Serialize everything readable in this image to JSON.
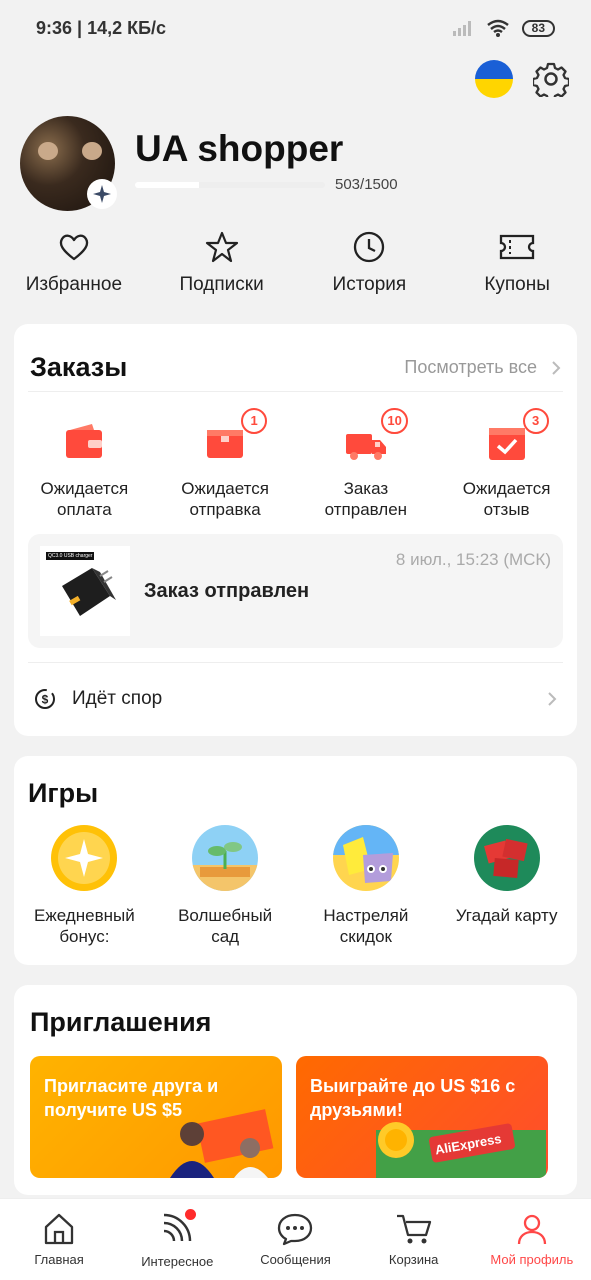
{
  "status_bar": {
    "time_speed": "9:36 | 14,2 КБ/с",
    "battery": "83"
  },
  "profile": {
    "username": "UA shopper",
    "progress_text": "503/1500",
    "progress": 0.335
  },
  "quick_links": [
    "Избранное",
    "Подписки",
    "История",
    "Купоны"
  ],
  "orders": {
    "title": "Заказы",
    "view_all": "Посмотреть все",
    "statuses": [
      {
        "label1": "Ожидается",
        "label2": "оплата",
        "count": ""
      },
      {
        "label1": "Ожидается",
        "label2": "отправка",
        "count": "1"
      },
      {
        "label1": "Заказ",
        "label2": "отправлен",
        "count": "10"
      },
      {
        "label1": "Ожидается",
        "label2": "отзыв",
        "count": "3"
      }
    ],
    "shipped": {
      "title": "Заказ отправлен",
      "time": "8 июл., 15:23 (МСК)",
      "thumb_label": "QC3.0 USB charger"
    },
    "dispute": "Идёт спор"
  },
  "games": {
    "title": "Игры",
    "items": [
      {
        "label1": "Ежедневный",
        "label2": "бонус:"
      },
      {
        "label1": "Волшебный",
        "label2": "сад"
      },
      {
        "label1": "Настреляй",
        "label2": "скидок"
      },
      {
        "label1": "Угадай карту",
        "label2": ""
      }
    ]
  },
  "invites": {
    "title": "Приглашения",
    "banner1": "Пригласите друга и получите US $5",
    "banner2": "Выиграйте до US $16 с друзьями!",
    "logo": "AliExpress"
  },
  "bottom_nav": [
    "Главная",
    "Интересное",
    "Сообщения",
    "Корзина",
    "Мой профиль"
  ],
  "colors": {
    "accent": "#ff4747",
    "order_icon": "#ff4a3c"
  }
}
